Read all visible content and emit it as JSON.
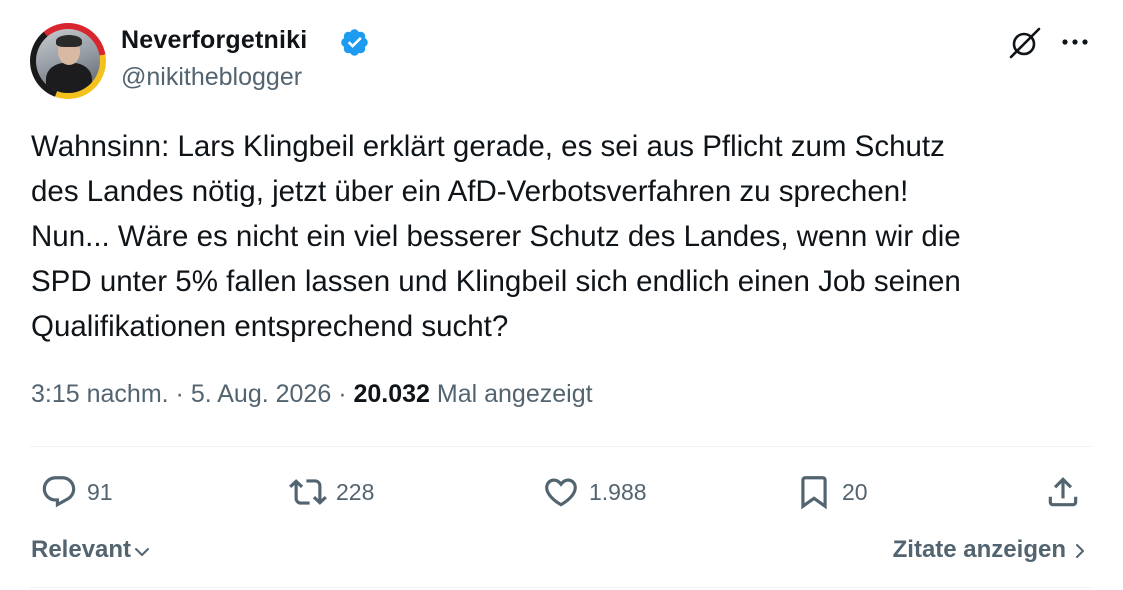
{
  "author": {
    "display_name": "Neverforgetniki",
    "handle": "@nikitheblogger",
    "verified": true
  },
  "tweet": {
    "text": "Wahnsinn: Lars Klingbeil erklärt gerade, es sei aus Pflicht zum Schutz\ndes Landes nötig, jetzt über ein AfD-Verbotsverfahren zu sprechen!\nNun... Wäre es nicht ein viel besserer Schutz des Landes, wenn wir die\nSPD unter 5% fallen lassen und Klingbeil sich endlich einen Job seinen\nQualifikationen entsprechend sucht?",
    "time": "3:15 nachm.",
    "separator": "·",
    "date": "5. Aug. 2026",
    "views_count": "20.032",
    "views_label": "Mal angezeigt"
  },
  "actions": {
    "replies": "91",
    "reposts": "228",
    "likes": "1.988",
    "bookmarks": "20"
  },
  "footer": {
    "sort_label": "Relevant",
    "quotes_label": "Zitate anzeigen"
  },
  "icons": [
    "grok-icon",
    "more-icon",
    "verified-badge-icon",
    "reply-icon",
    "repost-icon",
    "like-icon",
    "bookmark-icon",
    "share-icon",
    "chevron-down-icon",
    "chevron-right-icon"
  ],
  "colors": {
    "text_primary": "#0f1419",
    "text_secondary": "#536471",
    "verified_blue": "#1d9bf0",
    "divider": "#eff3f4"
  }
}
